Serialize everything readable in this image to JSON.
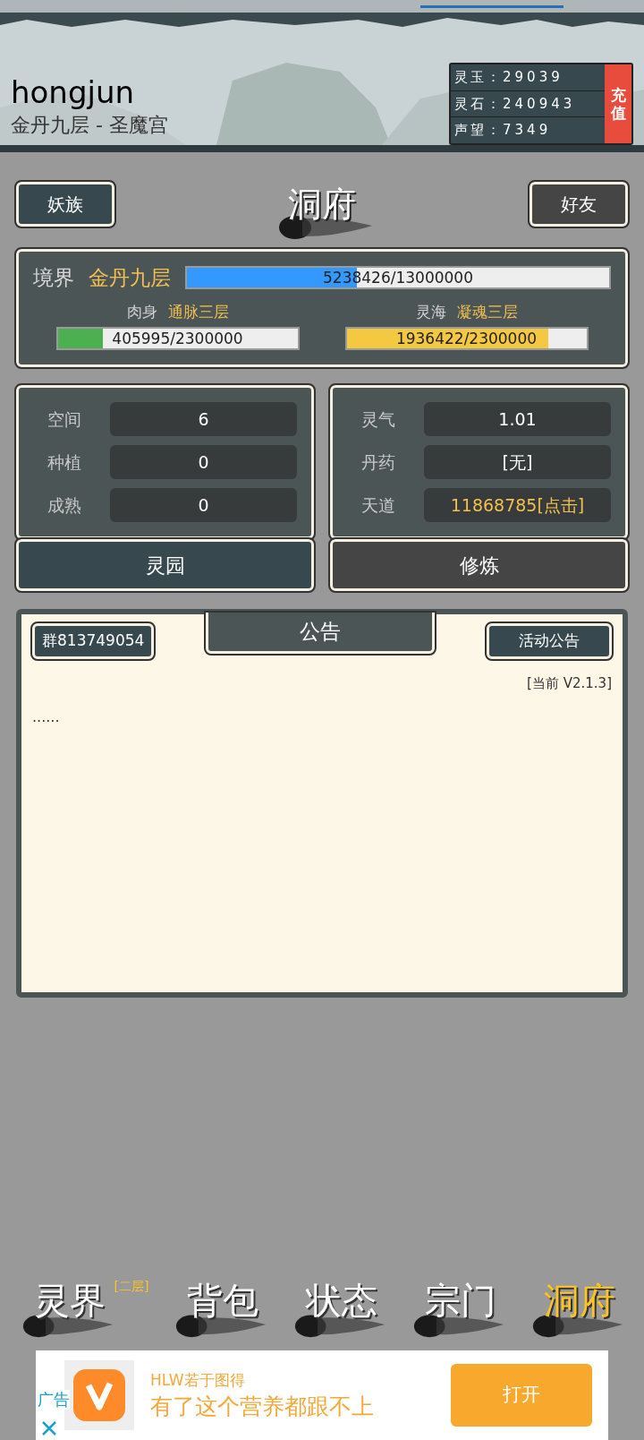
{
  "header": {
    "kind": "picture",
    "username": "hongjun",
    "subtitle": "金丹九层 - 圣魔宫",
    "currencies": [
      {
        "label": "灵玉：",
        "value": "29039"
      },
      {
        "label": "灵石：",
        "value": "240943"
      },
      {
        "label": "声望：",
        "value": "7349"
      }
    ],
    "recharge": "充值"
  },
  "top_bar": {
    "left_button": "妖族",
    "title": "洞府",
    "right_button": "好友"
  },
  "realm": {
    "label": "境界",
    "value": "金丹九层",
    "level": 0.403,
    "reading": "5238426/13000000",
    "subs": [
      {
        "label": "肉身",
        "value": "通脉三层",
        "level": 0.19,
        "reading": "405995/2300000",
        "color": "#4caf50"
      },
      {
        "label": "灵海",
        "value": "凝魂三层",
        "level": 0.84,
        "reading": "1936422/2300000",
        "color": "#f5c842"
      }
    ]
  },
  "panels": [
    {
      "rows": [
        {
          "label": "空间",
          "value": "6",
          "highlight": false
        },
        {
          "label": "种植",
          "value": "0",
          "highlight": false
        },
        {
          "label": "成熟",
          "value": "0",
          "highlight": false
        }
      ],
      "button": "灵园",
      "selected": true
    },
    {
      "rows": [
        {
          "label": "灵气",
          "value": "1.01",
          "highlight": false
        },
        {
          "label": "丹药",
          "value": "[无]",
          "highlight": false
        },
        {
          "label": "天道",
          "value": "11868785[点击]",
          "highlight": true
        }
      ],
      "button": "修炼",
      "selected": false
    }
  ],
  "notice": {
    "group_button": "群813749054",
    "title": "公告",
    "event_button": "活动公告",
    "version": "[当前 V2.1.3]",
    "body": "......"
  },
  "nav": [
    {
      "label": "灵界",
      "badge": "[二层]",
      "selected": false
    },
    {
      "label": "背包",
      "selected": false
    },
    {
      "label": "状态",
      "selected": false
    },
    {
      "label": "宗门",
      "selected": false
    },
    {
      "label": "洞府",
      "selected": true
    }
  ],
  "ad": {
    "tag": "广告",
    "source": "HLW若于图得",
    "headline": "有了这个营养都跟不上",
    "button": "打开"
  }
}
